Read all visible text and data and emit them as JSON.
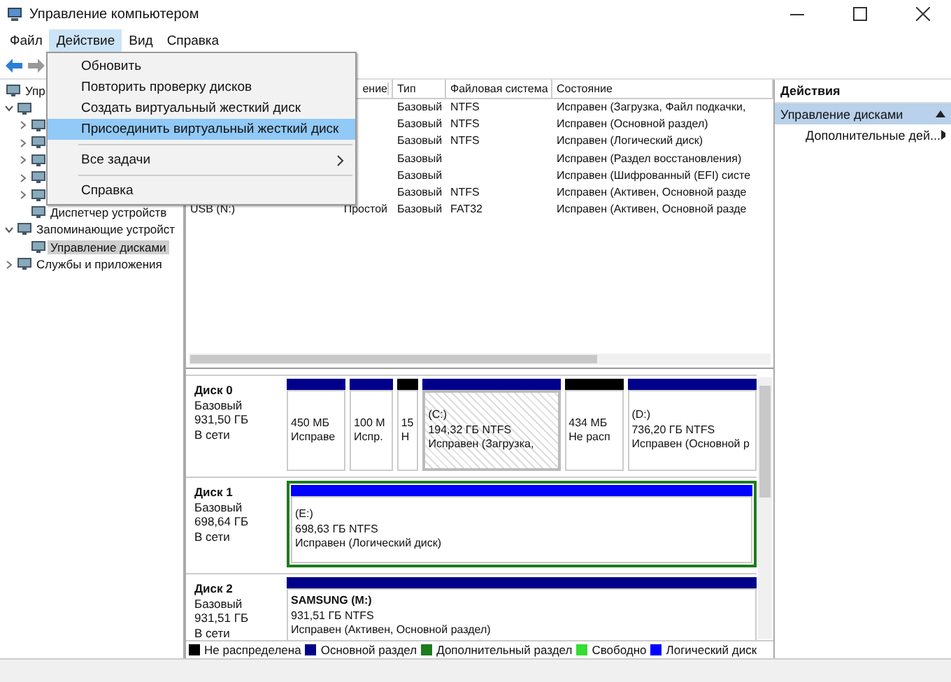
{
  "window": {
    "title": "Управление компьютером"
  },
  "menu_bar": [
    {
      "label": "Файл",
      "selected": false
    },
    {
      "label": "Действие",
      "selected": true
    },
    {
      "label": "Вид",
      "selected": false
    },
    {
      "label": "Справка",
      "selected": false
    }
  ],
  "action_menu": [
    {
      "kind": "item",
      "label": "Обновить",
      "selected": false
    },
    {
      "kind": "item",
      "label": "Повторить проверку дисков",
      "selected": false
    },
    {
      "kind": "item",
      "label": "Создать виртуальный жесткий диск",
      "selected": false
    },
    {
      "kind": "item",
      "label": "Присоединить виртуальный жесткий диск",
      "selected": true
    },
    {
      "kind": "separator"
    },
    {
      "kind": "submenu",
      "label": "Все задачи",
      "selected": false
    },
    {
      "kind": "separator"
    },
    {
      "kind": "item",
      "label": "Справка",
      "selected": false
    }
  ],
  "tree": [
    {
      "label": "Упр",
      "selected": false,
      "children": [
        {
          "expanded": true,
          "children": [
            {
              "expanded": false
            },
            {
              "expanded": false
            },
            {
              "expanded": false
            },
            {
              "expanded": false
            },
            {
              "expanded": false
            },
            {
              "label": "Диспетчер устройств",
              "selected": false
            }
          ]
        },
        {
          "label": "Запоминающие устройст",
          "expanded": true,
          "selected": false,
          "children": [
            {
              "label": "Управление дисками",
              "selected": true
            }
          ]
        },
        {
          "label": "Службы и приложения",
          "expanded": false,
          "selected": false
        }
      ]
    }
  ],
  "table": {
    "columns": [
      "ение",
      "Тип",
      "Файловая система",
      "Состояние"
    ],
    "rows": [
      {
        "volume": "",
        "layout": "",
        "type": "Базовый",
        "fs": "NTFS",
        "status": "Исправен (Загрузка, Файл подкачки,"
      },
      {
        "volume": "",
        "layout": "",
        "type": "Базовый",
        "fs": "NTFS",
        "status": "Исправен (Основной раздел)"
      },
      {
        "volume": "",
        "layout": "",
        "type": "Базовый",
        "fs": "NTFS",
        "status": "Исправен (Логический диск)"
      },
      {
        "volume": "",
        "layout": "",
        "type": "Базовый",
        "fs": "",
        "status": "Исправен (Раздел восстановления)"
      },
      {
        "volume": "",
        "layout": "",
        "type": "Базовый",
        "fs": "",
        "status": "Исправен (Шифрованный (EFI) систе"
      },
      {
        "volume": "",
        "layout": "",
        "type": "Базовый",
        "fs": "NTFS",
        "status": "Исправен (Активен, Основной разде"
      },
      {
        "volume": "USB (N:)",
        "layout": "Простой",
        "type": "Базовый",
        "fs": "FAT32",
        "status": "Исправен (Активен, Основной разде"
      }
    ]
  },
  "disks": [
    {
      "name": "Диск 0",
      "type": "Базовый",
      "size": "931,50 ГБ",
      "state": "В сети",
      "partitions": [
        {
          "lines": [
            "450 МБ",
            "Исправе"
          ],
          "color": "#00008b",
          "selected": false,
          "extended": false
        },
        {
          "lines": [
            "100 М",
            "Испр."
          ],
          "color": "#00008b",
          "selected": false,
          "extended": false
        },
        {
          "lines": [
            "15",
            "Н"
          ],
          "color": "#000000",
          "selected": false,
          "extended": false
        },
        {
          "label": "(C:)",
          "lines": [
            "194,32 ГБ NTFS",
            "Исправен (Загрузка,"
          ],
          "color": "#00008b",
          "selected": true,
          "extended": false
        },
        {
          "lines": [
            "434 МБ",
            "Не расп"
          ],
          "color": "#000000",
          "selected": false,
          "extended": false
        },
        {
          "label": "(D:)",
          "lines": [
            "736,20 ГБ NTFS",
            "Исправен (Основной р"
          ],
          "color": "#00008b",
          "selected": false,
          "extended": false
        }
      ]
    },
    {
      "name": "Диск 1",
      "type": "Базовый",
      "size": "698,64 ГБ",
      "state": "В сети",
      "partitions": [
        {
          "label": "(E:)",
          "lines": [
            "698,63 ГБ NTFS",
            "Исправен (Логический диск)"
          ],
          "color": "#0000ff",
          "selected": false,
          "extended": true
        }
      ]
    },
    {
      "name": "Диск 2",
      "type": "Базовый",
      "size": "931,51 ГБ",
      "state": "В сети",
      "partitions": [
        {
          "label": "SAMSUNG  (M:)",
          "lines": [
            "931,51 ГБ NTFS",
            "Исправен (Активен, Основной раздел)"
          ],
          "color": "#00008b",
          "selected": false,
          "extended": false
        }
      ]
    }
  ],
  "legend": [
    {
      "label": "Не распределена",
      "color": "#000000"
    },
    {
      "label": "Основной раздел",
      "color": "#00008b"
    },
    {
      "label": "Дополнительный раздел",
      "color": "#1e7b1e"
    },
    {
      "label": "Свободно",
      "color": "#33dd33"
    },
    {
      "label": "Логический диск",
      "color": "#0000ff"
    }
  ],
  "actions": {
    "title": "Действия",
    "items": [
      {
        "label": "Управление дисками",
        "selected": true
      },
      {
        "label": "Дополнительные дей...",
        "selected": false
      }
    ]
  }
}
